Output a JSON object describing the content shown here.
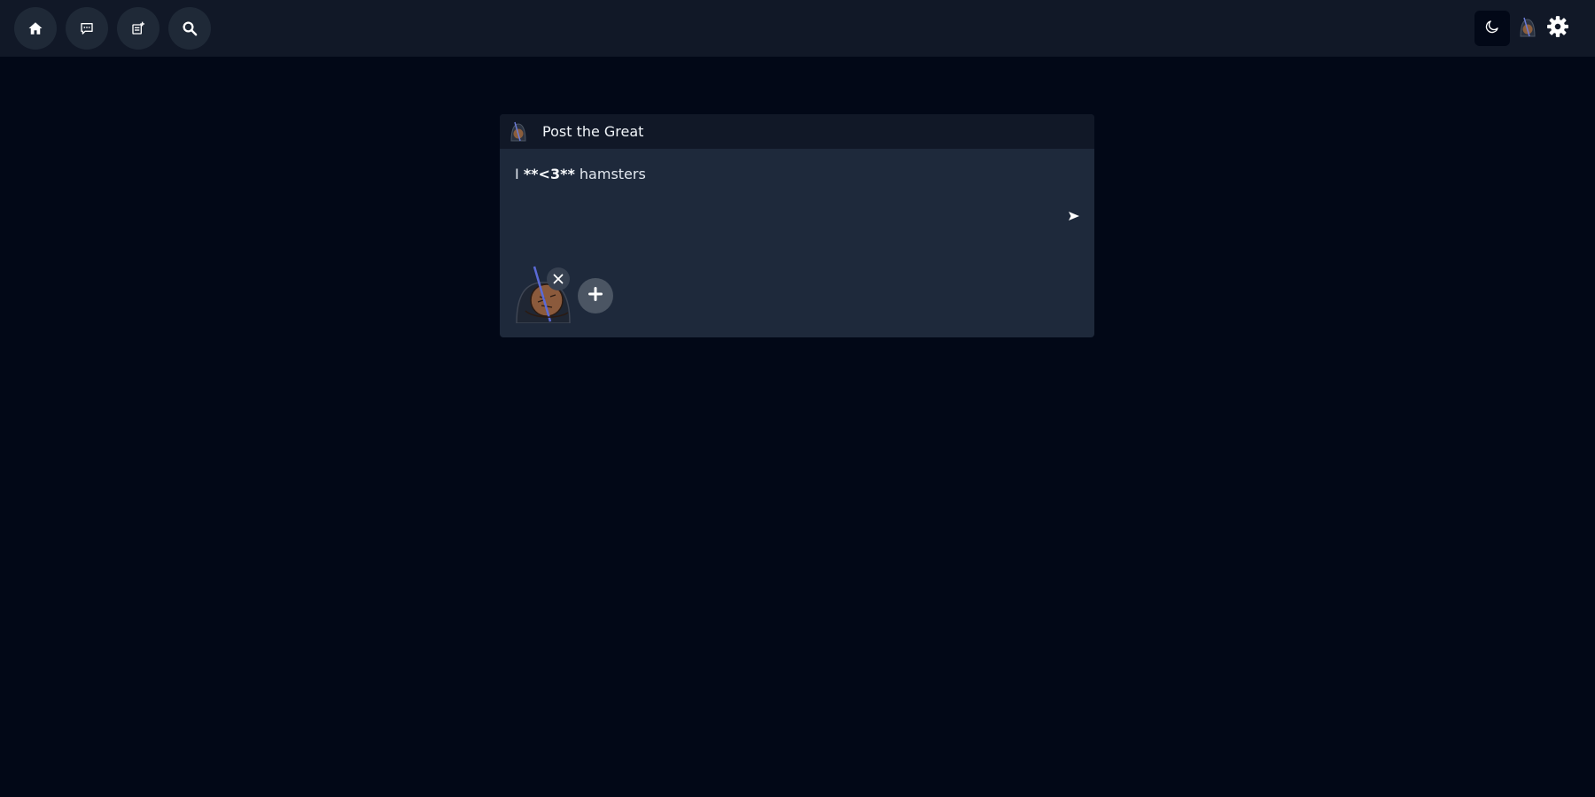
{
  "nav": {
    "items": [
      {
        "icon": "home-icon"
      },
      {
        "icon": "chat-icon"
      },
      {
        "icon": "new-post-icon"
      },
      {
        "icon": "search-icon"
      }
    ]
  },
  "top_right": {
    "theme_icon": "moon-icon",
    "avatar_icon": "avatar-icon",
    "settings_icon": "gear-icon"
  },
  "composer": {
    "title": "Post the Great",
    "text_prefix": "I ",
    "text_bold": "**<3**",
    "text_suffix": " hamsters",
    "send_icon": "send-icon",
    "remove_icon": "close-icon",
    "add_icon": "plus-icon",
    "attachment_icon": "attachment-thumbnail"
  },
  "colors": {
    "page_bg": "#020817",
    "topbar_bg": "#111827",
    "card_bg": "#1e293b",
    "nav_button_bg": "#1f2937"
  }
}
